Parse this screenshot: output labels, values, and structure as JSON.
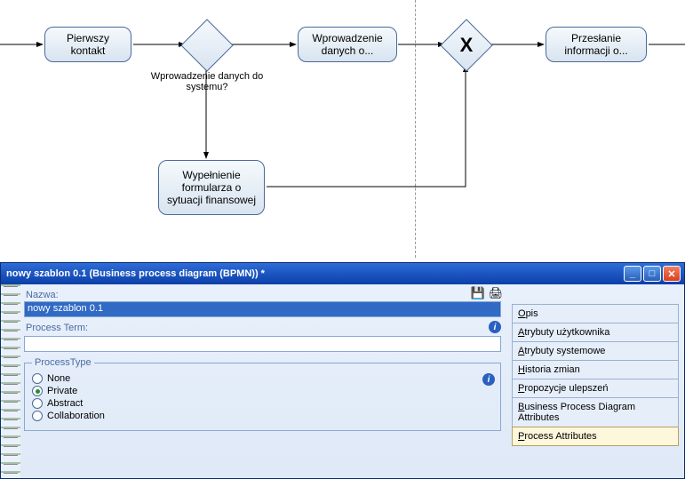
{
  "diagram": {
    "tasks": {
      "t1": "Pierwszy kontakt",
      "t2": "Wprowadzenie danych o...",
      "t3": "Wypełnienie formularza o sytuacji finansowej",
      "t4": "Przesłanie informacji o..."
    },
    "gateway_label": "Wprowadzenie danych do systemu?",
    "gateway_x": "X"
  },
  "window": {
    "title": "nowy szablon 0.1 (Business process diagram (BPMN)) *",
    "form": {
      "name_label": "Nazwa:",
      "name_value": "nowy szablon 0.1",
      "term_label": "Process Term:",
      "term_value": "",
      "ptype_legend": "ProcessType",
      "ptype": {
        "none": "None",
        "private": "Private",
        "abstract": "Abstract",
        "collaboration": "Collaboration"
      }
    },
    "nav": {
      "opis": "pis",
      "opis_u": "O",
      "atru": "trybuty użytkownika",
      "atru_u": "A",
      "atrs": "trybuty systemowe",
      "atrs_u": "A",
      "hist": "istoria zmian",
      "hist_u": "H",
      "prop": "ropozycje ulepszeń",
      "prop_u": "P",
      "bpd": "usiness Process Diagram Attributes",
      "bpd_u": "B",
      "pattr": "rocess Attributes",
      "pattr_u": "P"
    }
  }
}
